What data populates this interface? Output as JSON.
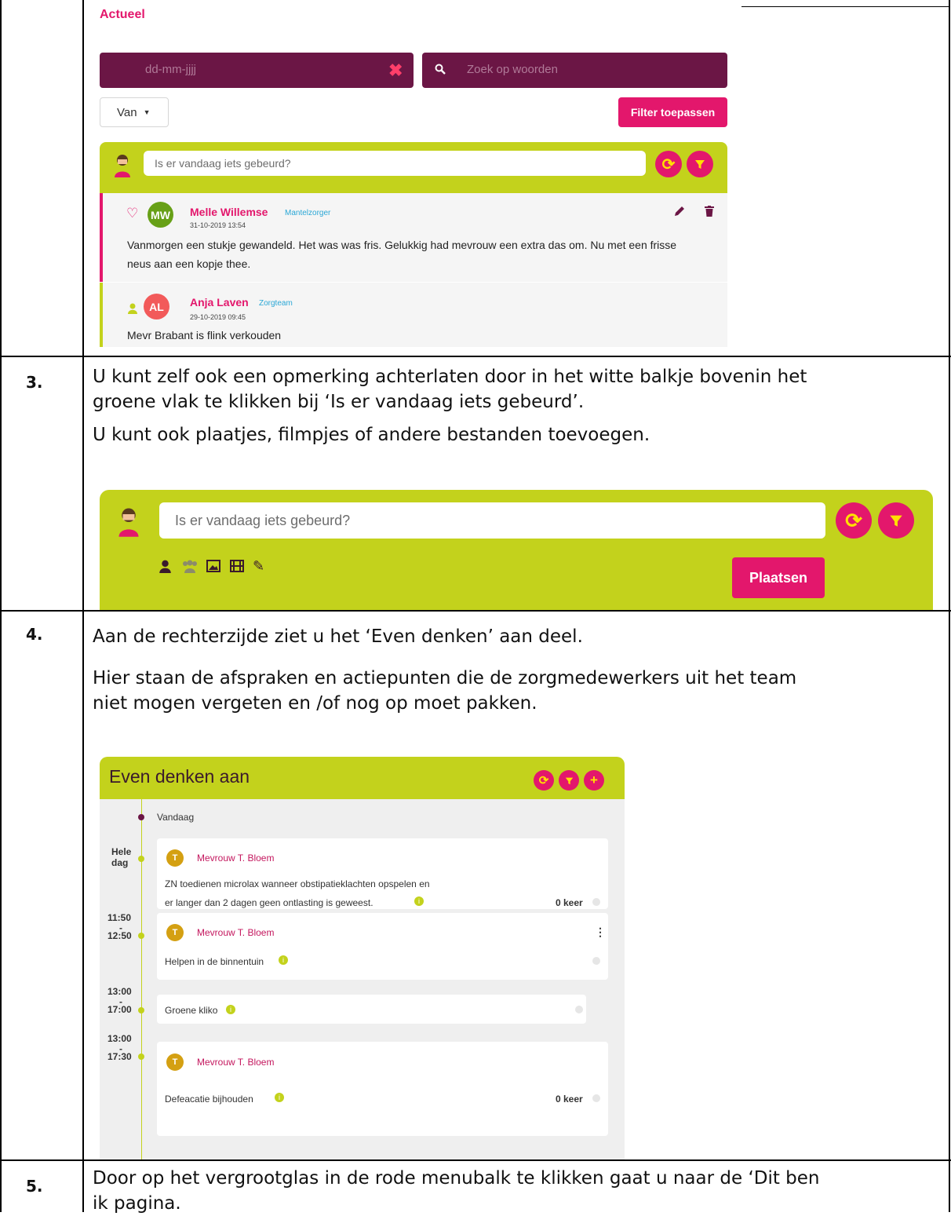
{
  "colors": {
    "plum": "#6b1645",
    "pink": "#e3176c",
    "lime": "#c3d21c",
    "panel": "#efefef"
  },
  "section1": {
    "heading": "Actueel",
    "date_placeholder": "dd-mm-jjjj",
    "search_placeholder": "Zoek op woorden",
    "van_label": "Van",
    "filter_button": "Filter toepassen",
    "compose_placeholder": "Is er vandaag iets gebeurd?",
    "posts": [
      {
        "initials": "MW",
        "name": "Melle Willemse",
        "role": "Mantelzorger",
        "timestamp": "31-10-2019 13:54",
        "text": "Vanmorgen een stukje gewandeld. Het was was fris. Gelukkig had mevrouw een extra das om. Nu met een frisse neus aan een kopje thee."
      },
      {
        "initials": "AL",
        "name": "Anja Laven",
        "role": "Zorgteam",
        "timestamp": "29-10-2019 09:45",
        "text": "Mevr Brabant is flink verkouden"
      }
    ]
  },
  "step3": {
    "number": "3.",
    "line1": "U kunt zelf ook een opmerking achterlaten door in het witte balkje bovenin het",
    "line2": "groene vlak te klikken bij ‘Is er vandaag iets gebeurd’.",
    "line3": "U kunt ook plaatjes, filmpjes of andere bestanden toevoegen.",
    "compose_placeholder": "Is er vandaag iets gebeurd?",
    "post_button": "Plaatsen",
    "toolbar_icons": [
      "person-icon",
      "group-icon",
      "image-icon",
      "film-icon",
      "paperclip-icon"
    ]
  },
  "step4": {
    "number": "4.",
    "line1": "Aan de rechterzijde ziet u het ‘Even denken’ aan deel.",
    "line2": "Hier staan de afspraken en actiepunten die de zorgmedewerkers uit het team",
    "line3": "niet mogen vergeten en /of nog op moet pakken.",
    "panel_title": "Even denken aan",
    "today": "Vandaag",
    "items": [
      {
        "time_a": "Hele",
        "time_b": "dag",
        "avatar": "T",
        "name": "Mevrouw T. Bloem",
        "text1": "ZN toedienen microlax wanneer obstipatieklachten opspelen en",
        "text2": "er langer dan 2 dagen geen ontlasting is geweest.",
        "count": "0 keer"
      },
      {
        "time_a": "11:50",
        "time_sep": "-",
        "time_b": "12:50",
        "avatar": "T",
        "name": "Mevrouw T. Bloem",
        "text1": "Helpen in de binnentuin",
        "menu": "⋮"
      },
      {
        "time_a": "13:00",
        "time_sep": "-",
        "time_b": "17:00",
        "text1": "Groene kliko"
      },
      {
        "time_a": "13:00",
        "time_sep": "-",
        "time_b": "17:30",
        "avatar": "T",
        "name": "Mevrouw T. Bloem",
        "text1": "Defeacatie bijhouden",
        "count": "0 keer"
      }
    ]
  },
  "step5": {
    "number": "5.",
    "line1": "Door op het vergrootglas in de rode menubalk te klikken gaat u naar de ‘Dit ben",
    "line2": "ik pagina."
  }
}
